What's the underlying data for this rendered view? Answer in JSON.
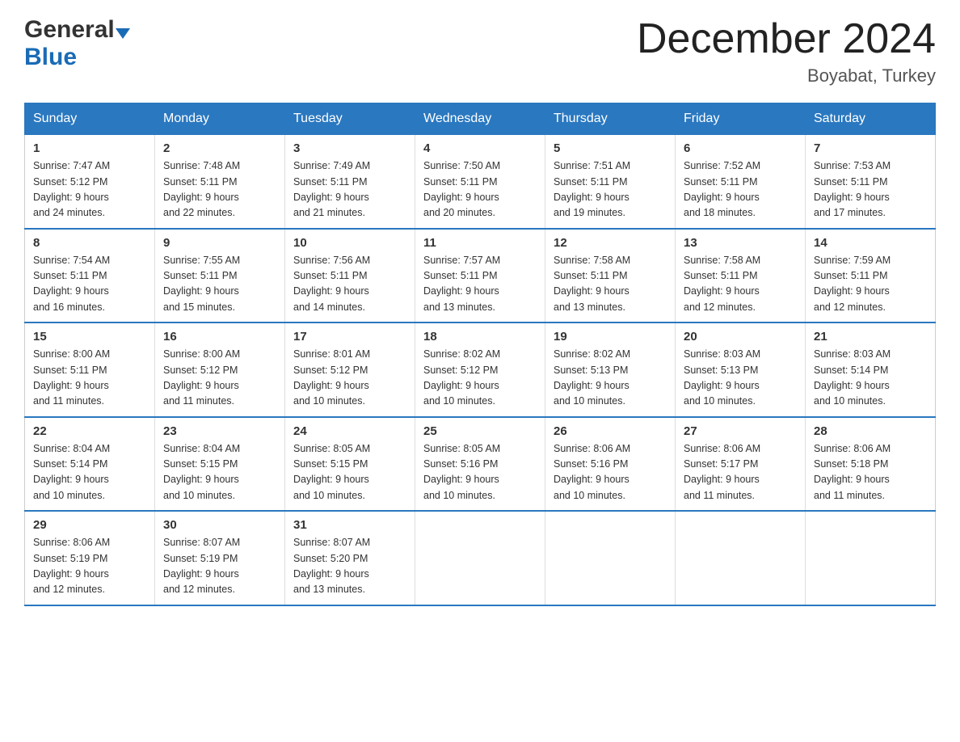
{
  "header": {
    "logo_general": "General",
    "logo_blue": "Blue",
    "month_title": "December 2024",
    "location": "Boyabat, Turkey"
  },
  "days_of_week": [
    "Sunday",
    "Monday",
    "Tuesday",
    "Wednesday",
    "Thursday",
    "Friday",
    "Saturday"
  ],
  "weeks": [
    [
      {
        "day": "1",
        "sunrise": "7:47 AM",
        "sunset": "5:12 PM",
        "daylight": "9 hours and 24 minutes."
      },
      {
        "day": "2",
        "sunrise": "7:48 AM",
        "sunset": "5:11 PM",
        "daylight": "9 hours and 22 minutes."
      },
      {
        "day": "3",
        "sunrise": "7:49 AM",
        "sunset": "5:11 PM",
        "daylight": "9 hours and 21 minutes."
      },
      {
        "day": "4",
        "sunrise": "7:50 AM",
        "sunset": "5:11 PM",
        "daylight": "9 hours and 20 minutes."
      },
      {
        "day": "5",
        "sunrise": "7:51 AM",
        "sunset": "5:11 PM",
        "daylight": "9 hours and 19 minutes."
      },
      {
        "day": "6",
        "sunrise": "7:52 AM",
        "sunset": "5:11 PM",
        "daylight": "9 hours and 18 minutes."
      },
      {
        "day": "7",
        "sunrise": "7:53 AM",
        "sunset": "5:11 PM",
        "daylight": "9 hours and 17 minutes."
      }
    ],
    [
      {
        "day": "8",
        "sunrise": "7:54 AM",
        "sunset": "5:11 PM",
        "daylight": "9 hours and 16 minutes."
      },
      {
        "day": "9",
        "sunrise": "7:55 AM",
        "sunset": "5:11 PM",
        "daylight": "9 hours and 15 minutes."
      },
      {
        "day": "10",
        "sunrise": "7:56 AM",
        "sunset": "5:11 PM",
        "daylight": "9 hours and 14 minutes."
      },
      {
        "day": "11",
        "sunrise": "7:57 AM",
        "sunset": "5:11 PM",
        "daylight": "9 hours and 13 minutes."
      },
      {
        "day": "12",
        "sunrise": "7:58 AM",
        "sunset": "5:11 PM",
        "daylight": "9 hours and 13 minutes."
      },
      {
        "day": "13",
        "sunrise": "7:58 AM",
        "sunset": "5:11 PM",
        "daylight": "9 hours and 12 minutes."
      },
      {
        "day": "14",
        "sunrise": "7:59 AM",
        "sunset": "5:11 PM",
        "daylight": "9 hours and 12 minutes."
      }
    ],
    [
      {
        "day": "15",
        "sunrise": "8:00 AM",
        "sunset": "5:11 PM",
        "daylight": "9 hours and 11 minutes."
      },
      {
        "day": "16",
        "sunrise": "8:00 AM",
        "sunset": "5:12 PM",
        "daylight": "9 hours and 11 minutes."
      },
      {
        "day": "17",
        "sunrise": "8:01 AM",
        "sunset": "5:12 PM",
        "daylight": "9 hours and 10 minutes."
      },
      {
        "day": "18",
        "sunrise": "8:02 AM",
        "sunset": "5:12 PM",
        "daylight": "9 hours and 10 minutes."
      },
      {
        "day": "19",
        "sunrise": "8:02 AM",
        "sunset": "5:13 PM",
        "daylight": "9 hours and 10 minutes."
      },
      {
        "day": "20",
        "sunrise": "8:03 AM",
        "sunset": "5:13 PM",
        "daylight": "9 hours and 10 minutes."
      },
      {
        "day": "21",
        "sunrise": "8:03 AM",
        "sunset": "5:14 PM",
        "daylight": "9 hours and 10 minutes."
      }
    ],
    [
      {
        "day": "22",
        "sunrise": "8:04 AM",
        "sunset": "5:14 PM",
        "daylight": "9 hours and 10 minutes."
      },
      {
        "day": "23",
        "sunrise": "8:04 AM",
        "sunset": "5:15 PM",
        "daylight": "9 hours and 10 minutes."
      },
      {
        "day": "24",
        "sunrise": "8:05 AM",
        "sunset": "5:15 PM",
        "daylight": "9 hours and 10 minutes."
      },
      {
        "day": "25",
        "sunrise": "8:05 AM",
        "sunset": "5:16 PM",
        "daylight": "9 hours and 10 minutes."
      },
      {
        "day": "26",
        "sunrise": "8:06 AM",
        "sunset": "5:16 PM",
        "daylight": "9 hours and 10 minutes."
      },
      {
        "day": "27",
        "sunrise": "8:06 AM",
        "sunset": "5:17 PM",
        "daylight": "9 hours and 11 minutes."
      },
      {
        "day": "28",
        "sunrise": "8:06 AM",
        "sunset": "5:18 PM",
        "daylight": "9 hours and 11 minutes."
      }
    ],
    [
      {
        "day": "29",
        "sunrise": "8:06 AM",
        "sunset": "5:19 PM",
        "daylight": "9 hours and 12 minutes."
      },
      {
        "day": "30",
        "sunrise": "8:07 AM",
        "sunset": "5:19 PM",
        "daylight": "9 hours and 12 minutes."
      },
      {
        "day": "31",
        "sunrise": "8:07 AM",
        "sunset": "5:20 PM",
        "daylight": "9 hours and 13 minutes."
      },
      null,
      null,
      null,
      null
    ]
  ],
  "labels": {
    "sunrise_prefix": "Sunrise: ",
    "sunset_prefix": "Sunset: ",
    "daylight_prefix": "Daylight: "
  }
}
